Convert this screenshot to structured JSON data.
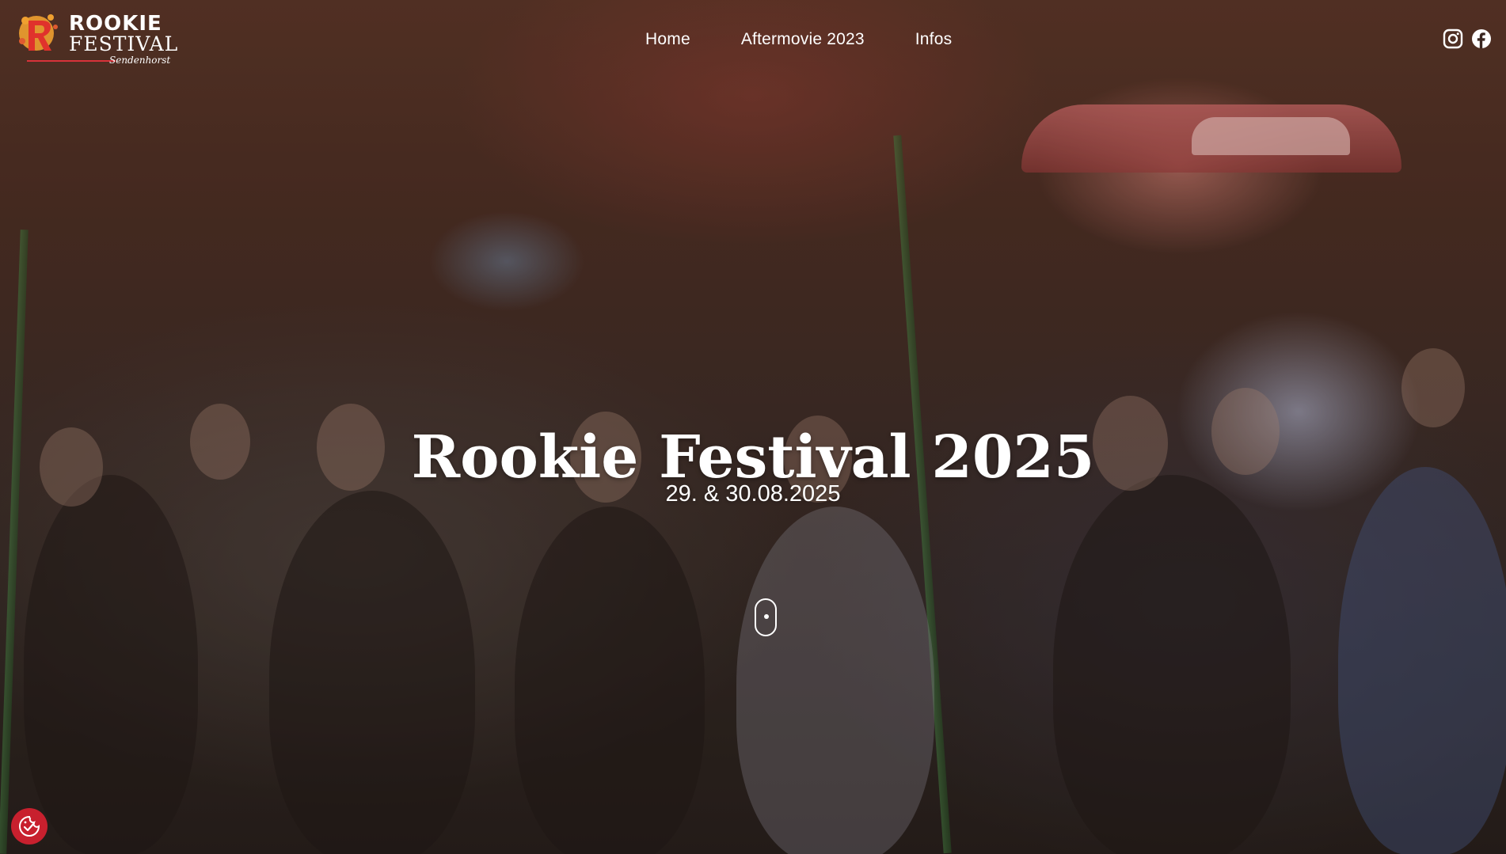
{
  "header": {
    "logo": {
      "title": "ROOKIE",
      "subtitle": "FESTIVAL",
      "town": "Sendenhorst",
      "mark_icon": "rookie-r-splash-logo"
    },
    "nav": [
      {
        "label": "Home"
      },
      {
        "label": "Aftermovie 2023"
      },
      {
        "label": "Infos"
      }
    ],
    "social": [
      {
        "icon": "instagram-icon"
      },
      {
        "icon": "facebook-icon"
      }
    ]
  },
  "hero": {
    "title": "Rookie Festival 2025",
    "dates": "29. & 30.08.2025",
    "scroll_indicator_icon": "mouse-scroll-icon"
  },
  "cookie_button": {
    "icon": "cookie-consent-icon"
  },
  "colors": {
    "accent": "#c8202e",
    "logo_orange": "#f0a030",
    "text": "#ffffff"
  }
}
